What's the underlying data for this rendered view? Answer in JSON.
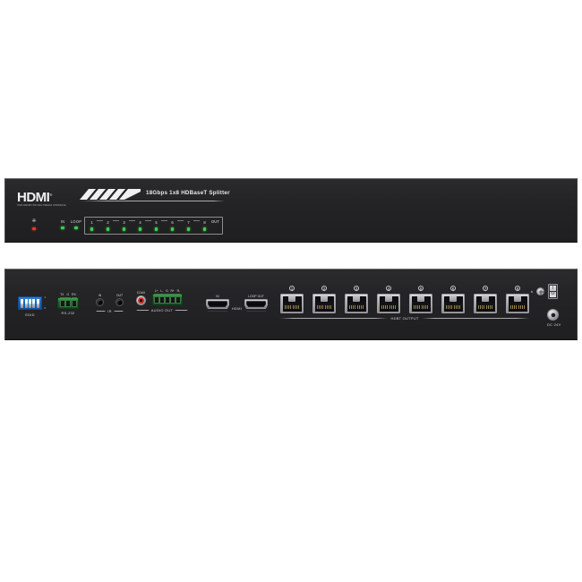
{
  "product": {
    "brand_logo": "HDMI",
    "brand_tagline": "HIGH-DEFINITION MULTIMEDIA INTERFACE",
    "title": "18Gbps 1x8 HDBaseT Splitter"
  },
  "front_panel": {
    "power_indicator": {
      "glyph": "power-icon",
      "led_color": "#e33b2a"
    },
    "indicators": [
      {
        "label": "IN",
        "led_color": "#3ad34a"
      },
      {
        "label": "LOOP",
        "led_color": "#3ad34a"
      }
    ],
    "output_group": {
      "channels": [
        "1",
        "2",
        "3",
        "4",
        "5",
        "6",
        "7",
        "8"
      ],
      "suffix_label": "OUT",
      "led_color": "#3ad34a"
    }
  },
  "rear_panel": {
    "edid": {
      "caption": "EDID",
      "tick_top": "1",
      "tick_bottom": "0",
      "switch_count": 5
    },
    "rs232": {
      "caption": "RS-232",
      "pins": [
        "TX",
        "G",
        "RX"
      ]
    },
    "ir": {
      "caption": "IR",
      "ports": [
        "IN",
        "OUT"
      ]
    },
    "audio": {
      "caption": "AUDIO OUT",
      "coax_label": "COAX",
      "pins": [
        "L+",
        "L-",
        "G",
        "R+",
        "R-"
      ]
    },
    "hdmi": {
      "caption": "HDMI",
      "ports": [
        "IN",
        "LOOP OUT"
      ]
    },
    "hdbt": {
      "caption": "HDBT OUTPUT",
      "ports": [
        "1",
        "2",
        "3",
        "4",
        "5",
        "6",
        "7",
        "8"
      ]
    },
    "power": {
      "dc_caption": "DC 24V",
      "switch_on": "I",
      "switch_off": "O"
    }
  },
  "colors": {
    "chassis": "#242426",
    "led_green": "#3ad34a",
    "led_red": "#e33b2a",
    "dip_blue": "#1c64bb",
    "terminal_green": "#1d6128",
    "rca_red": "#c22a1c"
  }
}
